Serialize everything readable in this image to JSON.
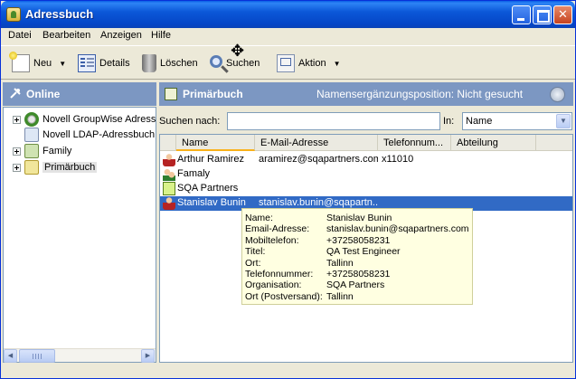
{
  "window": {
    "title": "Adressbuch"
  },
  "menu": {
    "items": [
      "Datei",
      "Bearbeiten",
      "Anzeigen",
      "Hilfe"
    ]
  },
  "toolbar": {
    "neu": "Neu",
    "details": "Details",
    "loeschen": "Löschen",
    "suchen": "Suchen",
    "aktion": "Aktion"
  },
  "left": {
    "header": "Online",
    "items": [
      {
        "label": "Novell GroupWise Adress",
        "icon": "groupwise-icon"
      },
      {
        "label": "Novell LDAP-Adressbuch",
        "icon": "ldap-icon"
      },
      {
        "label": "Family",
        "icon": "book-icon"
      },
      {
        "label": "Primärbuch",
        "icon": "book-icon"
      }
    ]
  },
  "right": {
    "header": "Primärbuch",
    "status": "Namensergänzungsposition: Nicht gesucht",
    "search_label": "Suchen nach:",
    "search_value": "",
    "in_label": "In:",
    "in_value": "Name"
  },
  "list": {
    "columns": [
      "Name",
      "E-Mail-Adresse",
      "Telefonnum...",
      "Abteilung"
    ],
    "rows": [
      {
        "name": "Arthur Ramirez",
        "email": "aramirez@sqapartners.com",
        "phone": "x11010",
        "dept": "",
        "icon": "person-icon"
      },
      {
        "name": "Famaly",
        "email": "",
        "phone": "",
        "dept": "",
        "icon": "group-icon"
      },
      {
        "name": "SQA Partners",
        "email": "",
        "phone": "",
        "dept": "",
        "icon": "organization-icon"
      },
      {
        "name": "Stanislav Bunin",
        "email": "stanislav.bunin@sqapartn...",
        "phone": "",
        "dept": "",
        "icon": "person-icon"
      }
    ]
  },
  "tooltip": {
    "rows": [
      {
        "key": "Name:",
        "value": "Stanislav Bunin"
      },
      {
        "key": "Email-Adresse:",
        "value": "stanislav.bunin@sqapartners.com"
      },
      {
        "key": "Mobiltelefon:",
        "value": "+37258058231"
      },
      {
        "key": "Titel:",
        "value": "QA Test Engineer"
      },
      {
        "key": "Ort:",
        "value": "Tallinn"
      },
      {
        "key": "Telefonnummer:",
        "value": "+37258058231"
      },
      {
        "key": "Organisation:",
        "value": "SQA Partners"
      },
      {
        "key": "Ort (Postversand):",
        "value": "Tallinn"
      }
    ]
  }
}
